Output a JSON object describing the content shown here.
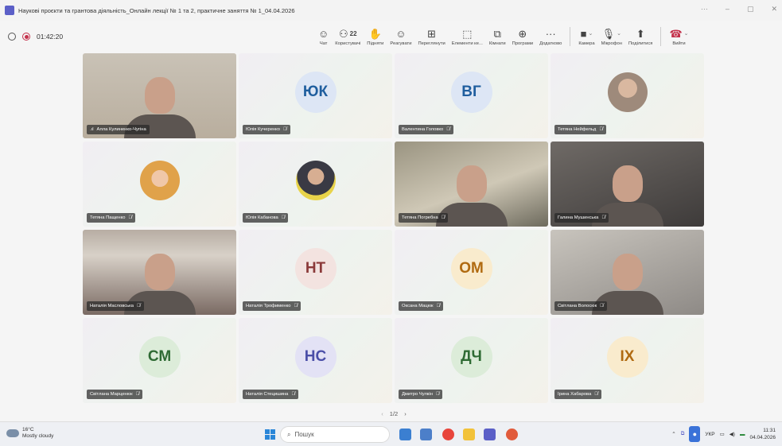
{
  "window": {
    "title": "Наукові проєкти та грантова діяльність_Онлайн лекції № 1 та 2, практичне заняття № 1_04.04.2026",
    "controls": [
      "···",
      "–",
      "▢",
      "✕"
    ]
  },
  "meeting": {
    "timer": "01:42:20",
    "toolbar": [
      {
        "id": "chat",
        "label": "Чат",
        "icon": "☺"
      },
      {
        "id": "people",
        "label": "Користувачі",
        "icon": "⚇",
        "count": "22"
      },
      {
        "id": "raise",
        "label": "Підняти",
        "icon": "✋"
      },
      {
        "id": "react",
        "label": "Реагувати",
        "icon": "☺"
      },
      {
        "id": "view",
        "label": "Переглянути",
        "icon": "⊞"
      },
      {
        "id": "elements",
        "label": "Елементи ке...",
        "icon": "⬚"
      },
      {
        "id": "rooms",
        "label": "Кімнати",
        "icon": "⧉"
      },
      {
        "id": "apps",
        "label": "Програми",
        "icon": "⊕"
      },
      {
        "id": "more",
        "label": "Додатково",
        "icon": "···"
      }
    ],
    "media": [
      {
        "id": "camera",
        "label": "Камера",
        "icon": "■"
      },
      {
        "id": "mic",
        "label": "Мікрофон",
        "icon": "🎙"
      },
      {
        "id": "share",
        "label": "Поділитися",
        "icon": "⬆"
      },
      {
        "id": "leave",
        "label": "Вийти",
        "icon": "☎"
      }
    ]
  },
  "participants": [
    {
      "name": "Алла Кулиненко-Чугіна",
      "type": "video",
      "muted": false
    },
    {
      "name": "Юлія Кучеренко",
      "type": "initials",
      "initials": "ЮК",
      "color": "#1f5e9e",
      "bg": "#dde6f5",
      "muted": true
    },
    {
      "name": "Валентина Головко",
      "type": "initials",
      "initials": "ВГ",
      "color": "#1f5e9e",
      "bg": "#dde6f5",
      "muted": true
    },
    {
      "name": "Тетяна Нейфельд",
      "type": "photo",
      "muted": true
    },
    {
      "name": "Тетяна Пащенко",
      "type": "photo",
      "muted": true
    },
    {
      "name": "Юлія Кабанова",
      "type": "photo",
      "muted": true
    },
    {
      "name": "Тетяна Погребна",
      "type": "video",
      "muted": true
    },
    {
      "name": "Галина Мушинська",
      "type": "video",
      "muted": true
    },
    {
      "name": "Наталія Масловська",
      "type": "video",
      "muted": true
    },
    {
      "name": "Наталія Трофименко",
      "type": "initials",
      "initials": "НТ",
      "color": "#8b3a3a",
      "bg": "#f3e3e0",
      "muted": true
    },
    {
      "name": "Оксана Мацюк",
      "type": "initials",
      "initials": "ОМ",
      "color": "#b06a10",
      "bg": "#f9ebcd",
      "muted": true
    },
    {
      "name": "Світлана Волосюк",
      "type": "video",
      "muted": true
    },
    {
      "name": "Світлана Марценюк",
      "type": "initials",
      "initials": "СМ",
      "color": "#2f6b34",
      "bg": "#dcecd9",
      "muted": true
    },
    {
      "name": "Наталія Стецишина",
      "type": "initials",
      "initials": "НС",
      "color": "#4b4fa8",
      "bg": "#e3e2f5",
      "muted": true
    },
    {
      "name": "Дмитро Чулкін",
      "type": "initials",
      "initials": "ДЧ",
      "color": "#2f6b34",
      "bg": "#dcecd9",
      "muted": true
    },
    {
      "name": "Ірина Хабарова",
      "type": "initials",
      "initials": "ІХ",
      "color": "#b06a10",
      "bg": "#f9ebcd",
      "muted": true
    }
  ],
  "pager": {
    "text": "1/2",
    "prev": "‹",
    "next": "›"
  },
  "taskbar": {
    "temperature": "16°C",
    "weather": "Mostly cloudy",
    "search_placeholder": "Пошук",
    "language": "УКР",
    "time": "11:31",
    "date": "04.04.2026"
  }
}
